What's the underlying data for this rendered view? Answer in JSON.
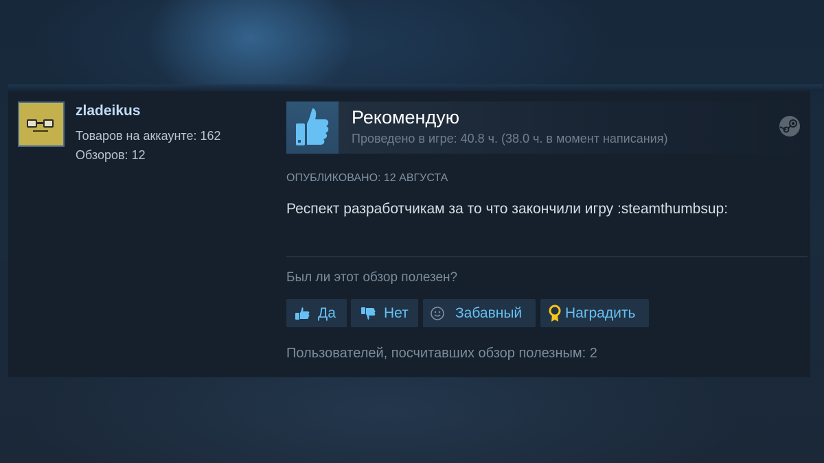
{
  "author": {
    "name": "zladeikus",
    "products_on_account": "Товаров на аккаунте: 162",
    "reviews_count": "Обзоров: 12"
  },
  "review": {
    "verdict": "Рекомендую",
    "playtime": "Проведено в игре: 40.8 ч. (38.0 ч. в момент написания)",
    "posted_date": "ОПУБЛИКОВАНО: 12 АВГУСТА",
    "text": "Респект разработчикам за то что закончили игру :steamthumbsup:"
  },
  "feedback": {
    "question": "Был ли этот обзор полезен?",
    "yes_label": "Да",
    "no_label": "Нет",
    "funny_label": "Забавный",
    "award_label": "Наградить",
    "helpful_count_text": "Пользователей, посчитавших обзор полезным: 2"
  },
  "icons": {
    "verdict": "thumbs-up-icon",
    "platform": "steam-icon",
    "yes": "thumbs-up-icon",
    "no": "thumbs-down-icon",
    "funny": "smiley-icon",
    "award": "award-ribbon-icon"
  },
  "colors": {
    "background": "#1b2838",
    "card": "#16202d",
    "accent_link": "#66c0f4",
    "username": "#c1dbf4",
    "thumb_up": "#66c0f4",
    "award": "#f5c518"
  }
}
